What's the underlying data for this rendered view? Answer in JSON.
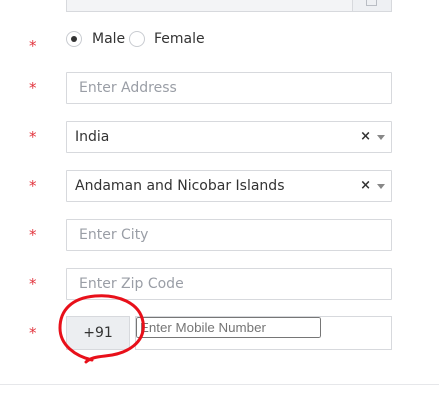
{
  "required_marker": "*",
  "gender": {
    "options": [
      {
        "label": "Male",
        "selected": true
      },
      {
        "label": "Female",
        "selected": false
      }
    ]
  },
  "address": {
    "placeholder": "Enter Address",
    "value": ""
  },
  "country": {
    "value": "India",
    "clear_symbol": "×"
  },
  "state": {
    "value": "Andaman and Nicobar Islands",
    "clear_symbol": "×"
  },
  "city": {
    "placeholder": "Enter City",
    "value": ""
  },
  "zip": {
    "placeholder": "Enter Zip Code",
    "value": ""
  },
  "mobile": {
    "prefix": "+91",
    "placeholder": "Enter Mobile Number",
    "value": ""
  },
  "colors": {
    "required": "#e2363f",
    "annotation": "#e8101a",
    "border": "#d7d9dd"
  }
}
